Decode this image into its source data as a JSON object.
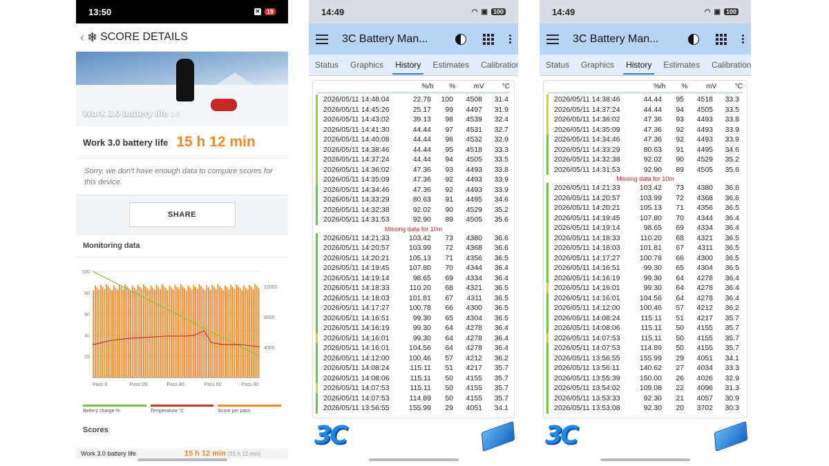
{
  "phone1": {
    "status": {
      "time": "13:50",
      "battery": "19"
    },
    "header": {
      "title": "SCORE DETAILS"
    },
    "hero": {
      "title": "Work 3.0 battery life",
      "suffix": "3.0"
    },
    "result": {
      "label": "Work 3.0 battery life",
      "value": "15 h 12 min"
    },
    "notice": "Sorry, we don't have enough data to compare scores for this device.",
    "share_label": "SHARE",
    "monitoring_title": "Monitoring data",
    "chart_data": {
      "type": "bar",
      "left_axis_ticks": [
        "100",
        "80",
        "60",
        "40",
        "20"
      ],
      "right_axis_ticks": [
        "12000",
        "8000",
        "4000"
      ],
      "x_ticks": [
        "Pass 0",
        "Pass 20",
        "Pass 40",
        "Pass 60",
        "Pass 80"
      ],
      "ylim_left": [
        0,
        100
      ],
      "ylim_right": [
        0,
        14000
      ],
      "series": [
        {
          "name": "Battery charge %",
          "color": "#7cc242",
          "points": [
            [
              0,
              100
            ],
            [
              90,
              20
            ]
          ]
        },
        {
          "name": "Temperature °C",
          "color": "#c0392b",
          "points": [
            [
              0,
              31
            ],
            [
              10,
              35
            ],
            [
              20,
              37
            ],
            [
              30,
              38
            ],
            [
              40,
              39
            ],
            [
              50,
              39
            ],
            [
              55,
              40
            ],
            [
              60,
              44
            ],
            [
              64,
              33
            ],
            [
              70,
              31
            ],
            [
              80,
              31
            ],
            [
              90,
              29
            ]
          ]
        },
        {
          "name": "Score per pass",
          "color": "#f0892a",
          "bar_range": [
            11500,
            12400
          ],
          "count": 90
        }
      ]
    },
    "legend": [
      {
        "label": "Battery charge %",
        "color": "#7cc242"
      },
      {
        "label": "Temperature °C",
        "color": "#c0392b"
      },
      {
        "label": "Score per pass",
        "color": "#f0892a"
      }
    ],
    "scores_title": "Scores",
    "scores_row": {
      "label": "Work 3.0 battery life",
      "value": "15 h 12 min",
      "sub": "(15 h 12 min)"
    }
  },
  "phone2": {
    "status": {
      "time": "14:49",
      "battery": "100"
    },
    "app_title": "3C Battery Man...",
    "tabs": [
      "Status",
      "Graphics",
      "History",
      "Estimates",
      "Calibration"
    ],
    "active_tab": "History",
    "columns": [
      "",
      "%/h",
      "%",
      "mV",
      "°C"
    ],
    "rows": [
      {
        "ts": "2026/05/11 14:48:04",
        "rate": "22.78",
        "pct": "100",
        "mv": "4508",
        "t": "31.4",
        "mk": "#9acd32"
      },
      {
        "ts": "2026/05/11 14:45:26",
        "rate": "25.17",
        "pct": "99",
        "mv": "4497",
        "t": "31.9",
        "mk": "#9acd32"
      },
      {
        "ts": "2026/05/11 14:43:02",
        "rate": "39.13",
        "pct": "98",
        "mv": "4539",
        "t": "32.4",
        "mk": "#9acd32"
      },
      {
        "ts": "2026/05/11 14:41:30",
        "rate": "44.44",
        "pct": "97",
        "mv": "4531",
        "t": "32.7",
        "mk": "#9acd32"
      },
      {
        "ts": "2026/05/11 14:40:08",
        "rate": "44.44",
        "pct": "96",
        "mv": "4532",
        "t": "32.9",
        "mk": "#9acd32"
      },
      {
        "ts": "2026/05/11 14:38:46",
        "rate": "44.44",
        "pct": "95",
        "mv": "4518",
        "t": "33.3",
        "mk": "#9acd32"
      },
      {
        "ts": "2026/05/11 14:37:24",
        "rate": "44.44",
        "pct": "94",
        "mv": "4505",
        "t": "33.5",
        "mk": "#9acd32"
      },
      {
        "ts": "2026/05/11 14:36:02",
        "rate": "47.36",
        "pct": "93",
        "mv": "4493",
        "t": "33.8",
        "mk": "#9acd32"
      },
      {
        "ts": "2026/05/11 14:35:09",
        "rate": "47.36",
        "pct": "92",
        "mv": "4493",
        "t": "33.9",
        "mk": "#9acd32"
      },
      {
        "ts": "2026/05/11 14:34:46",
        "rate": "47.36",
        "pct": "92",
        "mv": "4493",
        "t": "33.9",
        "mk": "#66cc33"
      },
      {
        "ts": "2026/05/11 14:33:29",
        "rate": "80.63",
        "pct": "91",
        "mv": "4495",
        "t": "34.6",
        "mk": "#66cc33"
      },
      {
        "ts": "2026/05/11 14:32:38",
        "rate": "92.02",
        "pct": "90",
        "mv": "4529",
        "t": "35.2",
        "mk": "#66cc33"
      },
      {
        "ts": "2026/05/11 14:31:53",
        "rate": "92.90",
        "pct": "89",
        "mv": "4505",
        "t": "35.6",
        "mk": "#66cc33"
      },
      {
        "gap": "Missing data for 10m"
      },
      {
        "ts": "2026/05/11 14:21:33",
        "rate": "103.42",
        "pct": "73",
        "mv": "4380",
        "t": "36.6",
        "mk": "#66cc33"
      },
      {
        "ts": "2026/05/11 14:20:57",
        "rate": "103.99",
        "pct": "72",
        "mv": "4368",
        "t": "36.6",
        "mk": "#66cc33"
      },
      {
        "ts": "2026/05/11 14:20:21",
        "rate": "105.13",
        "pct": "71",
        "mv": "4356",
        "t": "36.5",
        "mk": "#66cc33"
      },
      {
        "ts": "2026/05/11 14:19:45",
        "rate": "107.80",
        "pct": "70",
        "mv": "4344",
        "t": "36.4",
        "mk": "#66cc33"
      },
      {
        "ts": "2026/05/11 14:19:14",
        "rate": "98.65",
        "pct": "69",
        "mv": "4334",
        "t": "36.4",
        "mk": "#66cc33"
      },
      {
        "ts": "2026/05/11 14:18:33",
        "rate": "110.20",
        "pct": "68",
        "mv": "4321",
        "t": "36.5",
        "mk": "#66cc33"
      },
      {
        "ts": "2026/05/11 14:18:03",
        "rate": "101.81",
        "pct": "67",
        "mv": "4311",
        "t": "36.5",
        "mk": "#66cc33"
      },
      {
        "ts": "2026/05/11 14:17:27",
        "rate": "100.78",
        "pct": "66",
        "mv": "4300",
        "t": "36.5",
        "mk": "#66cc33"
      },
      {
        "ts": "2026/05/11 14:16:51",
        "rate": "99.30",
        "pct": "65",
        "mv": "4304",
        "t": "36.5",
        "mk": "#66cc33"
      },
      {
        "ts": "2026/05/11 14:16:19",
        "rate": "99.30",
        "pct": "64",
        "mv": "4278",
        "t": "36.4",
        "mk": "#66cc33"
      },
      {
        "ts": "2026/05/11 14:16:01",
        "rate": "99.30",
        "pct": "64",
        "mv": "4278",
        "t": "36.4",
        "mk": "#c5d92e"
      },
      {
        "ts": "2026/05/11 14:16:01",
        "rate": "104.56",
        "pct": "64",
        "mv": "4278",
        "t": "36.4",
        "mk": "#66cc33"
      },
      {
        "ts": "2026/05/11 14:12:00",
        "rate": "100.46",
        "pct": "57",
        "mv": "4212",
        "t": "36.2",
        "mk": "#66cc33"
      },
      {
        "ts": "2026/05/11 14:08:24",
        "rate": "115.11",
        "pct": "51",
        "mv": "4217",
        "t": "35.7",
        "mk": "#66cc33"
      },
      {
        "ts": "2026/05/11 14:08:06",
        "rate": "115.11",
        "pct": "50",
        "mv": "4155",
        "t": "35.7",
        "mk": "#66cc33"
      },
      {
        "ts": "2026/05/11 14:07:53",
        "rate": "115.11",
        "pct": "50",
        "mv": "4155",
        "t": "35.7",
        "mk": "#c5d92e"
      },
      {
        "ts": "2026/05/11 14:07:53",
        "rate": "114.89",
        "pct": "50",
        "mv": "4155",
        "t": "35.7",
        "mk": "#66cc33"
      },
      {
        "ts": "2026/05/11 13:56:55",
        "rate": "155.99",
        "pct": "29",
        "mv": "4051",
        "t": "34.1",
        "mk": "#66cc33"
      }
    ]
  },
  "phone3": {
    "status": {
      "time": "14:49",
      "battery": "100"
    },
    "app_title": "3C Battery Man...",
    "tabs": [
      "Status",
      "Graphics",
      "History",
      "Estimates",
      "Calibration"
    ],
    "active_tab": "History",
    "columns": [
      "",
      "%/h",
      "%",
      "mV",
      "°C"
    ],
    "rows": [
      {
        "ts": "2026/05/11 14:38:46",
        "rate": "44.44",
        "pct": "95",
        "mv": "4518",
        "t": "33.3",
        "mk": "#c5d92e"
      },
      {
        "ts": "2026/05/11 14:37:24",
        "rate": "44.44",
        "pct": "94",
        "mv": "4505",
        "t": "33.5",
        "mk": "#c5d92e"
      },
      {
        "ts": "2026/05/11 14:36:02",
        "rate": "47.36",
        "pct": "93",
        "mv": "4493",
        "t": "33.8",
        "mk": "#c5d92e"
      },
      {
        "ts": "2026/05/11 14:35:09",
        "rate": "47.36",
        "pct": "92",
        "mv": "4493",
        "t": "33.9",
        "mk": "#c5d92e"
      },
      {
        "ts": "2026/05/11 14:34:46",
        "rate": "47.36",
        "pct": "92",
        "mv": "4493",
        "t": "33.9",
        "mk": "#66cc33"
      },
      {
        "ts": "2026/05/11 14:33:29",
        "rate": "80.63",
        "pct": "91",
        "mv": "4495",
        "t": "34.6",
        "mk": "#66cc33"
      },
      {
        "ts": "2026/05/11 14:32:38",
        "rate": "92.02",
        "pct": "90",
        "mv": "4529",
        "t": "35.2",
        "mk": "#66cc33"
      },
      {
        "ts": "2026/05/11 14:31:53",
        "rate": "92.90",
        "pct": "89",
        "mv": "4505",
        "t": "35.6",
        "mk": "#66cc33"
      },
      {
        "gap": "Missing data for 10m"
      },
      {
        "ts": "2026/05/11 14:21:33",
        "rate": "103.42",
        "pct": "73",
        "mv": "4380",
        "t": "36.6",
        "mk": "#66cc33"
      },
      {
        "ts": "2026/05/11 14:20:57",
        "rate": "103.99",
        "pct": "72",
        "mv": "4368",
        "t": "36.6",
        "mk": "#66cc33"
      },
      {
        "ts": "2026/05/11 14:20:21",
        "rate": "105.13",
        "pct": "71",
        "mv": "4356",
        "t": "36.5",
        "mk": "#66cc33"
      },
      {
        "ts": "2026/05/11 14:19:45",
        "rate": "107.80",
        "pct": "70",
        "mv": "4344",
        "t": "36.4",
        "mk": "#66cc33"
      },
      {
        "ts": "2026/05/11 14:19:14",
        "rate": "98.65",
        "pct": "69",
        "mv": "4334",
        "t": "36.4",
        "mk": "#66cc33"
      },
      {
        "ts": "2026/05/11 14:18:33",
        "rate": "110.20",
        "pct": "68",
        "mv": "4321",
        "t": "36.5",
        "mk": "#66cc33"
      },
      {
        "ts": "2026/05/11 14:18:03",
        "rate": "101.81",
        "pct": "67",
        "mv": "4311",
        "t": "36.5",
        "mk": "#66cc33"
      },
      {
        "ts": "2026/05/11 14:17:27",
        "rate": "100.78",
        "pct": "66",
        "mv": "4300",
        "t": "36.5",
        "mk": "#66cc33"
      },
      {
        "ts": "2026/05/11 14:16:51",
        "rate": "99.30",
        "pct": "65",
        "mv": "4304",
        "t": "36.5",
        "mk": "#66cc33"
      },
      {
        "ts": "2026/05/11 14:16:19",
        "rate": "99.30",
        "pct": "64",
        "mv": "4278",
        "t": "36.4",
        "mk": "#66cc33"
      },
      {
        "ts": "2026/05/11 14:16:01",
        "rate": "99.30",
        "pct": "64",
        "mv": "4278",
        "t": "36.4",
        "mk": "#c5d92e"
      },
      {
        "ts": "2026/05/11 14:16:01",
        "rate": "104.56",
        "pct": "64",
        "mv": "4278",
        "t": "36.4",
        "mk": "#66cc33"
      },
      {
        "ts": "2026/05/11 14:12:00",
        "rate": "100.46",
        "pct": "57",
        "mv": "4212",
        "t": "36.2",
        "mk": "#66cc33"
      },
      {
        "ts": "2026/05/11 14:08:24",
        "rate": "115.11",
        "pct": "51",
        "mv": "4217",
        "t": "35.7",
        "mk": "#66cc33"
      },
      {
        "ts": "2026/05/11 14:08:06",
        "rate": "115.11",
        "pct": "50",
        "mv": "4155",
        "t": "35.7",
        "mk": "#66cc33"
      },
      {
        "ts": "2026/05/11 14:07:53",
        "rate": "115.11",
        "pct": "50",
        "mv": "4155",
        "t": "35.7",
        "mk": "#c5d92e"
      },
      {
        "ts": "2026/05/11 14:07:53",
        "rate": "114.89",
        "pct": "50",
        "mv": "4155",
        "t": "35.7",
        "mk": "#66cc33"
      },
      {
        "ts": "2026/05/11 13:56:55",
        "rate": "155.99",
        "pct": "29",
        "mv": "4051",
        "t": "34.1",
        "mk": "#66cc33"
      },
      {
        "ts": "2026/05/11 13:56:11",
        "rate": "140.62",
        "pct": "27",
        "mv": "4034",
        "t": "33.3",
        "mk": "#66cc33"
      },
      {
        "ts": "2026/05/11 13:55:39",
        "rate": "150.00",
        "pct": "26",
        "mv": "4026",
        "t": "32.9",
        "mk": "#66cc33"
      },
      {
        "ts": "2026/05/11 13:54:02",
        "rate": "109.08",
        "pct": "22",
        "mv": "4096",
        "t": "31.3",
        "mk": "#66cc33"
      },
      {
        "ts": "2026/05/11 13:53:33",
        "rate": "92.30",
        "pct": "21",
        "mv": "4057",
        "t": "30.9",
        "mk": "#66cc33"
      },
      {
        "ts": "2026/05/11 13:53:08",
        "rate": "92.30",
        "pct": "20",
        "mv": "3702",
        "t": "30.3",
        "mk": "#66cc33"
      }
    ]
  },
  "logo_text": "3C"
}
